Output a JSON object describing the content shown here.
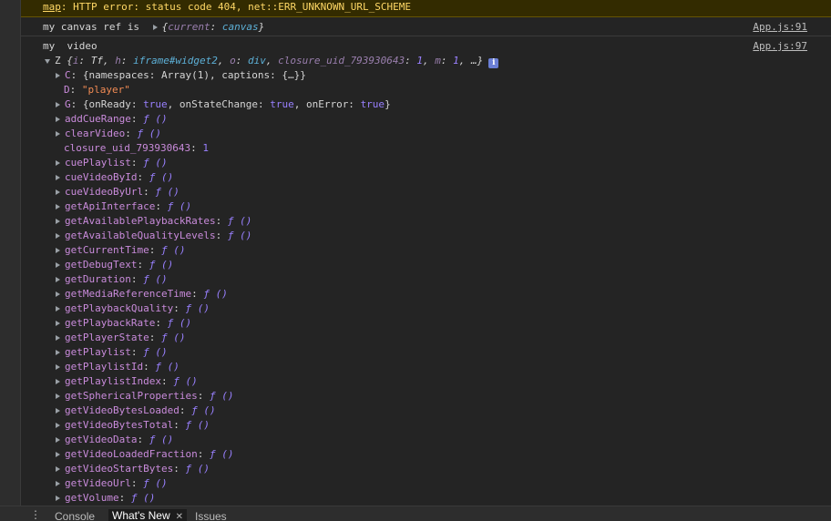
{
  "warning": {
    "prefix": "map",
    "text": ": HTTP error: status code 404, net::ERR_UNKNOWN_URL_SCHEME"
  },
  "canvas_log": {
    "label": "my canvas ref is",
    "object_key": "current",
    "object_value": "canvas",
    "source": "App.js:91"
  },
  "video_log": {
    "label": "my  video",
    "source": "App.js:97",
    "summary": {
      "name": "Z",
      "parts": [
        [
          "i",
          "Tf"
        ],
        [
          "h",
          "iframe#widget2"
        ],
        [
          "o",
          "div"
        ],
        [
          "closure_uid_793930643",
          "1"
        ],
        [
          "m",
          "1"
        ]
      ]
    },
    "properties": [
      {
        "key": "C",
        "expandable": true,
        "value": "{namespaces: Array(1), captions: {…}}",
        "type": "obj"
      },
      {
        "key": "D",
        "expandable": false,
        "value": "\"player\"",
        "type": "string"
      },
      {
        "key": "G",
        "expandable": true,
        "value": "{onReady: true, onStateChange: true, onError: true}",
        "type": "obj-bool"
      },
      {
        "key": "addCueRange",
        "expandable": true,
        "value": "ƒ ()",
        "type": "fn"
      },
      {
        "key": "clearVideo",
        "expandable": true,
        "value": "ƒ ()",
        "type": "fn"
      },
      {
        "key": "closure_uid_793930643",
        "expandable": false,
        "value": "1",
        "type": "number"
      },
      {
        "key": "cuePlaylist",
        "expandable": true,
        "value": "ƒ ()",
        "type": "fn"
      },
      {
        "key": "cueVideoById",
        "expandable": true,
        "value": "ƒ ()",
        "type": "fn"
      },
      {
        "key": "cueVideoByUrl",
        "expandable": true,
        "value": "ƒ ()",
        "type": "fn"
      },
      {
        "key": "getApiInterface",
        "expandable": true,
        "value": "ƒ ()",
        "type": "fn"
      },
      {
        "key": "getAvailablePlaybackRates",
        "expandable": true,
        "value": "ƒ ()",
        "type": "fn"
      },
      {
        "key": "getAvailableQualityLevels",
        "expandable": true,
        "value": "ƒ ()",
        "type": "fn"
      },
      {
        "key": "getCurrentTime",
        "expandable": true,
        "value": "ƒ ()",
        "type": "fn"
      },
      {
        "key": "getDebugText",
        "expandable": true,
        "value": "ƒ ()",
        "type": "fn"
      },
      {
        "key": "getDuration",
        "expandable": true,
        "value": "ƒ ()",
        "type": "fn"
      },
      {
        "key": "getMediaReferenceTime",
        "expandable": true,
        "value": "ƒ ()",
        "type": "fn"
      },
      {
        "key": "getPlaybackQuality",
        "expandable": true,
        "value": "ƒ ()",
        "type": "fn"
      },
      {
        "key": "getPlaybackRate",
        "expandable": true,
        "value": "ƒ ()",
        "type": "fn"
      },
      {
        "key": "getPlayerState",
        "expandable": true,
        "value": "ƒ ()",
        "type": "fn"
      },
      {
        "key": "getPlaylist",
        "expandable": true,
        "value": "ƒ ()",
        "type": "fn"
      },
      {
        "key": "getPlaylistId",
        "expandable": true,
        "value": "ƒ ()",
        "type": "fn"
      },
      {
        "key": "getPlaylistIndex",
        "expandable": true,
        "value": "ƒ ()",
        "type": "fn"
      },
      {
        "key": "getSphericalProperties",
        "expandable": true,
        "value": "ƒ ()",
        "type": "fn"
      },
      {
        "key": "getVideoBytesLoaded",
        "expandable": true,
        "value": "ƒ ()",
        "type": "fn"
      },
      {
        "key": "getVideoBytesTotal",
        "expandable": true,
        "value": "ƒ ()",
        "type": "fn"
      },
      {
        "key": "getVideoData",
        "expandable": true,
        "value": "ƒ ()",
        "type": "fn"
      },
      {
        "key": "getVideoLoadedFraction",
        "expandable": true,
        "value": "ƒ ()",
        "type": "fn"
      },
      {
        "key": "getVideoStartBytes",
        "expandable": true,
        "value": "ƒ ()",
        "type": "fn"
      },
      {
        "key": "getVideoUrl",
        "expandable": true,
        "value": "ƒ ()",
        "type": "fn"
      },
      {
        "key": "getVolume",
        "expandable": true,
        "value": "ƒ ()",
        "type": "fn"
      }
    ]
  },
  "drawer": {
    "tabs": [
      {
        "label": "Console",
        "active": false
      },
      {
        "label": "What's New",
        "active": true,
        "closable": true
      },
      {
        "label": "Issues",
        "active": false
      }
    ]
  }
}
